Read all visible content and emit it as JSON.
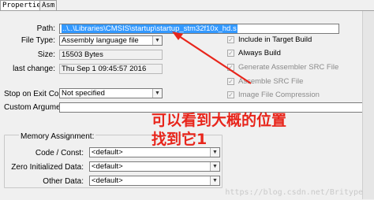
{
  "tabs": [
    {
      "label": "Properties"
    },
    {
      "label": "Asm"
    }
  ],
  "fields": {
    "path": {
      "label": "Path:",
      "value": "..\\..\\Libraries\\CMSIS\\startup\\startup_stm32f10x_hd.s"
    },
    "file_type": {
      "label": "File Type:",
      "value": "Assembly language file"
    },
    "size": {
      "label": "Size:",
      "value": "15503 Bytes"
    },
    "last_change": {
      "label": "last change:",
      "value": "Thu Sep  1 09:45:57 2016"
    },
    "stop_on_exit": {
      "label": "Stop on Exit Code:",
      "value": "Not specified"
    },
    "custom_args": {
      "label": "Custom Arguments:",
      "value": ""
    }
  },
  "checkboxes": [
    {
      "label": "Include in Target Build",
      "checked": true,
      "enabled": true
    },
    {
      "label": "Always Build",
      "checked": true,
      "enabled": true
    },
    {
      "label": "Generate Assembler SRC File",
      "checked": true,
      "enabled": false
    },
    {
      "label": "Assemble SRC File",
      "checked": true,
      "enabled": false
    },
    {
      "label": "Image File Compression",
      "checked": true,
      "enabled": false
    }
  ],
  "memory": {
    "title": "Memory Assignment:",
    "code_const": {
      "label": "Code / Const:",
      "value": "<default>"
    },
    "zero_init": {
      "label": "Zero Initialized Data:",
      "value": "<default>"
    },
    "other": {
      "label": "Other Data:",
      "value": "<default>"
    }
  },
  "annotation": {
    "line1": "可以看到大概的位置",
    "line2": "找到它1",
    "color": "#e8251b"
  },
  "watermark": "https://blog.csdn.net/Britype"
}
